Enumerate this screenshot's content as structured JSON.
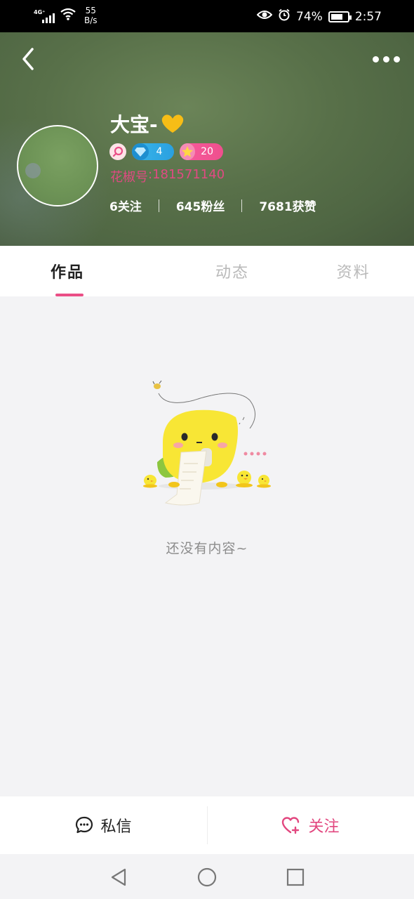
{
  "status_bar": {
    "network": "4G⁺",
    "speed_value": "55",
    "speed_unit": "B/s",
    "battery_percent": "74%",
    "battery_level": 0.74,
    "time": "2:57",
    "icons": [
      "signal-icon",
      "wifi-icon",
      "eye-icon",
      "alarm-icon",
      "battery-icon"
    ]
  },
  "profile": {
    "nickname": "大宝-",
    "nickname_emoji": "yellow-heart-icon",
    "diamond_level": "4",
    "star_level": "20",
    "id_label": "花椒号",
    "id_colon": ":",
    "id_value": "181571140",
    "following": "6关注",
    "fans": "645粉丝",
    "likes": "7681获赞"
  },
  "tabs": [
    {
      "label": "作品",
      "active": true
    },
    {
      "label": "动态",
      "active": false
    },
    {
      "label": "资料",
      "active": false
    }
  ],
  "empty_state": {
    "text": "还没有内容~"
  },
  "actions": {
    "message_label": "私信",
    "follow_label": "关注"
  },
  "colors": {
    "accent": "#e2477f",
    "id_pink": "#e04a82",
    "diamond_blue": "#2aa0e0",
    "star_pink": "#ef4f8d",
    "header_green": "#587049"
  }
}
